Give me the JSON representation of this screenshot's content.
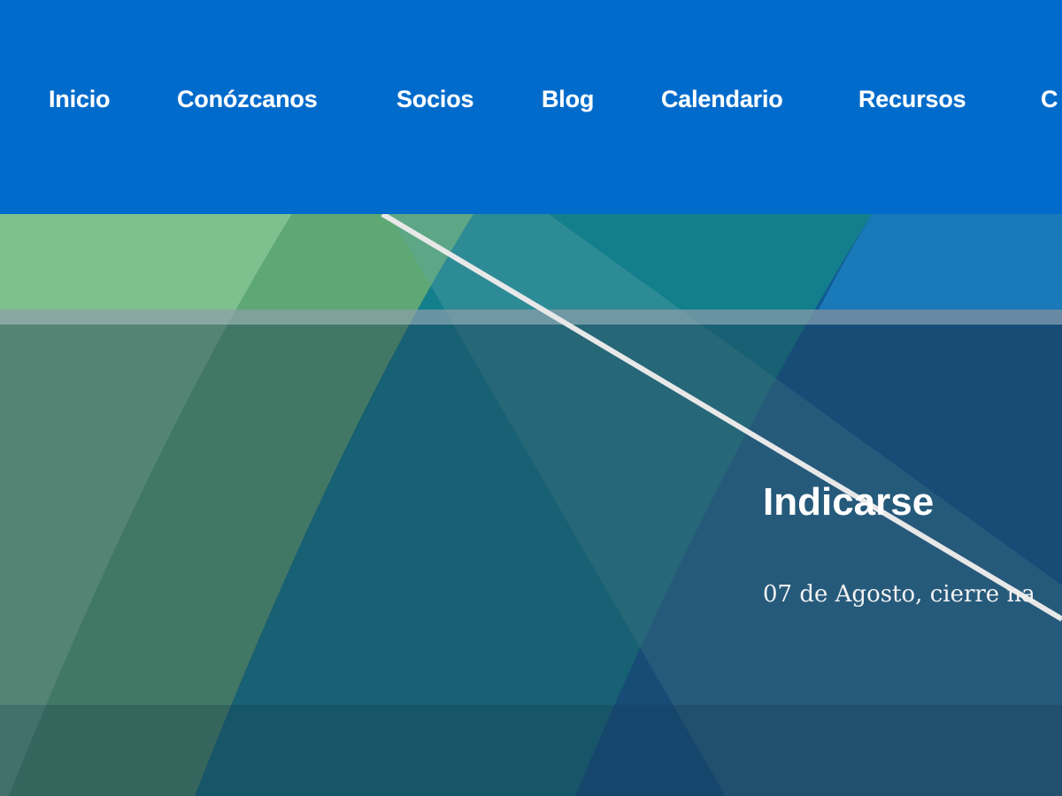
{
  "nav": {
    "items": [
      {
        "label": "Inicio"
      },
      {
        "label": "Conózcanos"
      },
      {
        "label": "Socios"
      },
      {
        "label": "Blog"
      },
      {
        "label": "Calendario"
      },
      {
        "label": "Recursos"
      },
      {
        "label": "C"
      }
    ]
  },
  "slide": {
    "title": "Indicarse",
    "text": "07 de Agosto, cierre na"
  },
  "colors": {
    "nav_background": "#006bcb",
    "text": "#ffffff"
  }
}
